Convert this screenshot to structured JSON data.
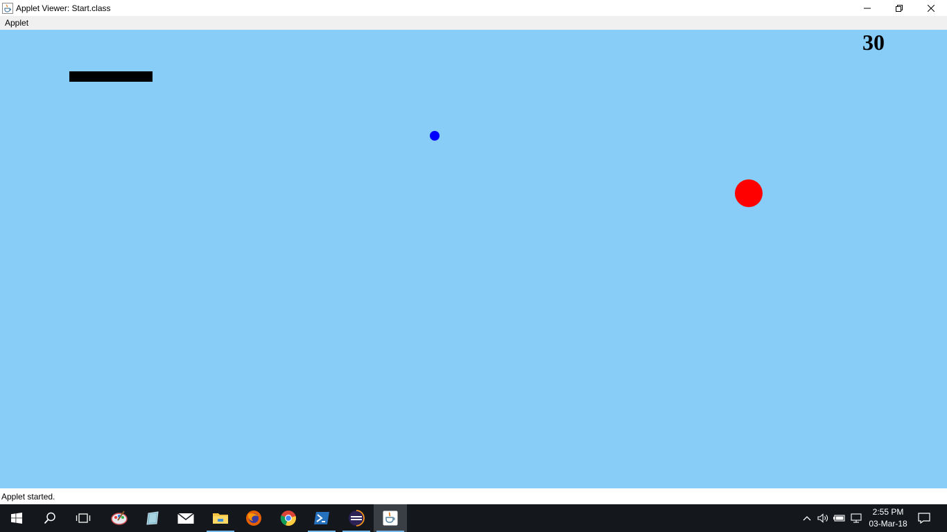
{
  "window": {
    "title": "Applet Viewer: Start.class",
    "icon": "java-cup-icon",
    "controls": [
      "minimize-icon",
      "restore-icon",
      "close-icon"
    ]
  },
  "menubar": {
    "items": [
      {
        "label": "Applet"
      }
    ]
  },
  "applet": {
    "background_color": "#87cdf8",
    "score": "30",
    "paddle_color": "#000000",
    "blue_ball_color": "#0000ff",
    "red_ball_color": "#ff0000"
  },
  "statusbar": {
    "text": "Applet started."
  },
  "taskbar": {
    "apps": [
      {
        "name": "start",
        "icon": "windows-logo-icon"
      },
      {
        "name": "search",
        "icon": "search-icon"
      },
      {
        "name": "task-view",
        "icon": "task-view-icon"
      },
      {
        "name": "paint",
        "icon": "palette-icon"
      },
      {
        "name": "notes",
        "icon": "notebook-icon"
      },
      {
        "name": "mail",
        "icon": "mail-icon"
      },
      {
        "name": "file-explorer",
        "icon": "folder-icon"
      },
      {
        "name": "firefox",
        "icon": "firefox-icon"
      },
      {
        "name": "chrome",
        "icon": "chrome-icon"
      },
      {
        "name": "powershell",
        "icon": "powershell-icon"
      },
      {
        "name": "eclipse",
        "icon": "eclipse-icon"
      },
      {
        "name": "java",
        "icon": "java-icon"
      }
    ],
    "tray_icons": [
      "chevron-up-icon",
      "volume-icon",
      "battery-icon",
      "network-icon"
    ],
    "clock": {
      "time": "2:55 PM",
      "date": "03-Mar-18"
    },
    "notification_icon": "action-center-icon"
  }
}
